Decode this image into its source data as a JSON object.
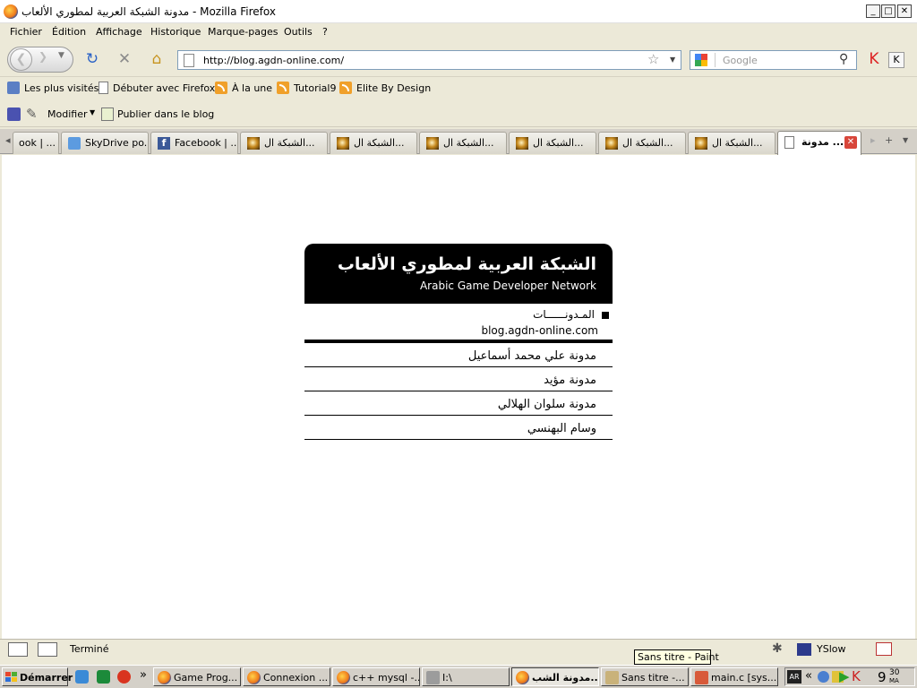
{
  "window": {
    "title": "مدونة الشبكة العربية لمطوري الألعاب - Mozilla Firefox",
    "minimize": "_",
    "maximize": "□",
    "close": "✕"
  },
  "menu": [
    "Fichier",
    "Édition",
    "Affichage",
    "Historique",
    "Marque-pages",
    "Outils",
    "?"
  ],
  "nav": {
    "url": "http://blog.agdn-online.com/",
    "search_placeholder": "Google"
  },
  "bookmarks": [
    {
      "label": "Les plus visités",
      "icon": "most-visited-icon"
    },
    {
      "label": "Débuter avec Firefox",
      "icon": "page-icon"
    },
    {
      "label": "À la une",
      "icon": "rss-icon"
    },
    {
      "label": "Tutorial9",
      "icon": "rss-icon"
    },
    {
      "label": "Elite By Design",
      "icon": "rss-icon"
    }
  ],
  "blog_toolbar": {
    "modify": "Modifier",
    "publish": "Publier dans le blog"
  },
  "tabs": [
    {
      "label": "ook | ..."
    },
    {
      "label": "SkyDrive po..."
    },
    {
      "label": "Facebook | ..."
    },
    {
      "label": "الشبكة ال..."
    },
    {
      "label": "الشبكة ال..."
    },
    {
      "label": "الشبكة ال..."
    },
    {
      "label": "الشبكة ال..."
    },
    {
      "label": "الشبكة ال..."
    },
    {
      "label": "الشبكة ال..."
    },
    {
      "label": "مدونة ..."
    }
  ],
  "page": {
    "header_ar": "الشبكة العربية لمطوري الألعاب",
    "header_en": "Arabic Game Developer Network",
    "section_label": "المـدونــــــات",
    "domain": "blog.agdn-online.com",
    "blogs": [
      "مدونة علي محمد أسماعيل",
      "مدونة مؤيد",
      "مدونة سلوان الهلالي",
      "وسام البهنسي"
    ]
  },
  "status": {
    "text": "Terminé",
    "yslow": "YSlow"
  },
  "taskbar": {
    "start": "Démarrer",
    "tasks": [
      "Game Prog...",
      "Connexion ...",
      "c++ mysql -...",
      "I:\\",
      "مدونة الشب...",
      "Sans titre -...",
      "main.c [sys..."
    ],
    "tooltip": "Sans titre - Paint",
    "clock": "9",
    "clock_min": "30",
    "clock_ampm": "MA",
    "tray_lang": "AR"
  }
}
